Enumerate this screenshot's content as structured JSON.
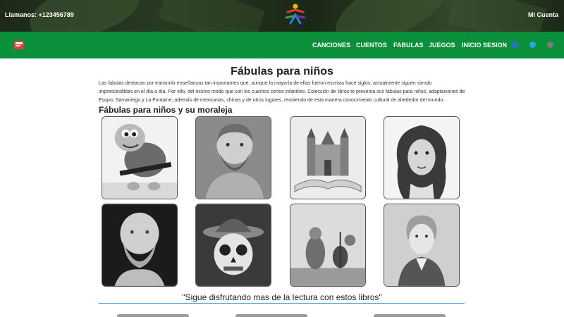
{
  "topbar": {
    "phone": "Llamanos: +123456789",
    "account": "Mi Cuenta"
  },
  "nav": {
    "links": [
      "CANCIONES",
      "CUENTOS",
      "FABULAS",
      "JUEGOS",
      "INICIO SESION"
    ],
    "social_icons": [
      "facebook-icon",
      "twitter-icon",
      "instagram-icon"
    ]
  },
  "main": {
    "title": "Fábulas para niños",
    "intro": "Las fábulas destacan por transmitir enseñanzas tan importantes que, aunque la mayoría de ellas fueron escritas hace siglos, actualmente siguen siendo imprescindibles en el día a día. Por ello, del mismo modo que con los cuentos cortos infantiles. Colección de libros te presenta sus fábulas para niños, adaptaciones de Esopo, Samaniego y La Fontaine, además de mexicanas, chinas y de otros lugares, reuniendo de esta manera conocimiento cultural de alrededor del mundo.",
    "section_title": "Fábulas para niños y su moraleja",
    "cards": [
      "turtle-cartoon",
      "aesop-bust",
      "castle-book",
      "la-fontaine-portrait",
      "plato-bust",
      "mexican-sugar-skull",
      "forest-musicians",
      "samaniego-portrait"
    ]
  },
  "footer": {
    "quote": "\"Sigue disfrutando mas de la lectura con estos libros\""
  },
  "colors": {
    "navbar": "#0a8f3a",
    "topbar": "#243320",
    "accent_line": "#3a9ad9"
  }
}
